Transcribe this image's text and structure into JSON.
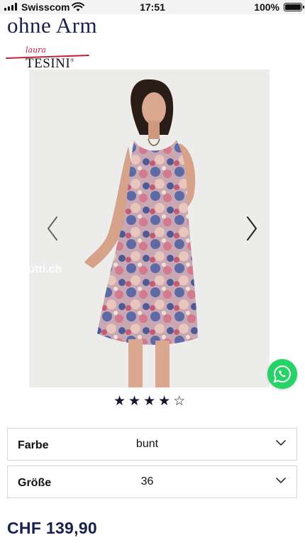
{
  "status_bar": {
    "carrier": "Swisscom",
    "time": "17:51",
    "battery": "100%",
    "battery_level": 1.0,
    "icons": [
      "signal-icon",
      "wifi-icon",
      "battery-icon"
    ]
  },
  "product": {
    "title": "ohne Arm",
    "brand": {
      "script": "laura",
      "name": "TESINI",
      "registered": "®"
    },
    "image": {
      "description_icon": "dress-photo",
      "watermark": "tutti.ch",
      "prev_icon": "chevron-left-icon",
      "next_icon": "chevron-right-icon"
    },
    "rating": {
      "value": 4,
      "max": 5
    },
    "options": {
      "color": {
        "label": "Farbe",
        "value": "bunt"
      },
      "size": {
        "label": "Größe",
        "value": "36"
      }
    },
    "price": "CHF 139,90"
  },
  "colors": {
    "title": "#1a1f4b",
    "brand_accent": "#c0213f",
    "whatsapp": "#25d366",
    "star": "#14172e"
  }
}
